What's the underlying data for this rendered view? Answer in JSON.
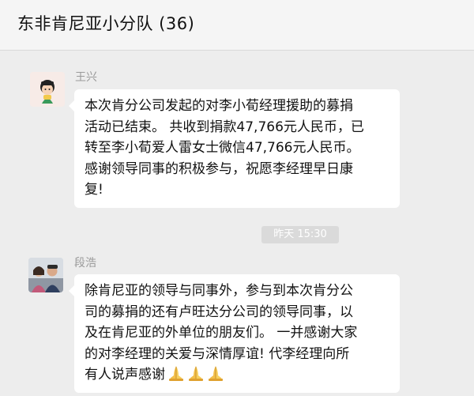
{
  "header": {
    "title": "东非肯尼亚小分队 (36)"
  },
  "messages": [
    {
      "sender": "王兴",
      "lines": [
        "本次肯分公司发起的对李小荀经理援助的募捐",
        "活动已结束。 共收到捐款47,766元人民币，已",
        "转至李小荀爱人雷女士微信47,766元人民币。",
        "感谢领导同事的积极参与，祝愿李经理早日康",
        "复!"
      ]
    },
    {
      "sender": "段浩",
      "lines": [
        "除肯尼亚的领导与同事外，参与到本次肯分公",
        "司的募捐的还有卢旺达分公司的领导同事，以",
        "及在肯尼亚的外单位的朋友们。 一并感谢大家",
        "的对李经理的关爱与深情厚谊! 代李经理向所",
        "有人说声感谢"
      ],
      "emoji": [
        "folded-hands",
        "folded-hands",
        "folded-hands"
      ]
    }
  ],
  "timestamp": "昨天 15:30"
}
